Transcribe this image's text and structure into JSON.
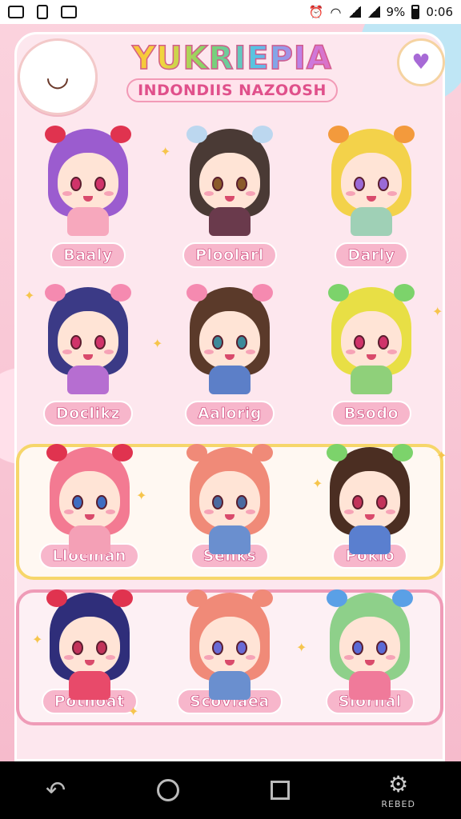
{
  "status_bar": {
    "battery": "9%",
    "time": "0:06"
  },
  "header": {
    "title": "YUKRIEPIA",
    "subtitle": "INDONDIIS NAZOOSH"
  },
  "characters": [
    {
      "name": "Baaly",
      "hair": "#9b5ccf",
      "bow": "#e0334f",
      "body": "#f7a8bd",
      "eyes": "#d0336a"
    },
    {
      "name": "Ploolarl",
      "hair": "#4a3a35",
      "bow": "#bcd7ef",
      "body": "#6a3a4c",
      "eyes": "#8a5a2a"
    },
    {
      "name": "Darly",
      "hair": "#f3d24a",
      "bow": "#f39a3c",
      "body": "#9fd0b6",
      "eyes": "#9a6ad6"
    },
    {
      "name": "Doclikz",
      "hair": "#3b3a86",
      "bow": "#f58ab0",
      "body": "#b66ed1",
      "eyes": "#d0336a"
    },
    {
      "name": "Aalorig",
      "hair": "#5b3a2a",
      "bow": "#f58ab0",
      "body": "#5c7fc8",
      "eyes": "#3c8a9a"
    },
    {
      "name": "Bsodo",
      "hair": "#e8df45",
      "bow": "#7cd36b",
      "body": "#8fd07a",
      "eyes": "#d0336a"
    },
    {
      "name": "Llocman",
      "hair": "#f37a92",
      "bow": "#e0334f",
      "body": "#f4a0b6",
      "eyes": "#3f6dc1"
    },
    {
      "name": "Senks",
      "hair": "#f08a78",
      "bow": "#f08a78",
      "body": "#6a8fcf",
      "eyes": "#4a6aa0"
    },
    {
      "name": "Poklo",
      "hair": "#4b2e22",
      "bow": "#7cd36b",
      "body": "#5a7fcf",
      "eyes": "#c2335a"
    },
    {
      "name": "Potnoat",
      "hair": "#2f2e7a",
      "bow": "#e0334f",
      "body": "#e84a6a",
      "eyes": "#c2335a"
    },
    {
      "name": "Scovlaea",
      "hair": "#f08a78",
      "bow": "#f08a78",
      "body": "#6a8fcf",
      "eyes": "#6a6ad6"
    },
    {
      "name": "Siorlial",
      "hair": "#8ed08a",
      "bow": "#5aa0e6",
      "body": "#f07a9a",
      "eyes": "#5a6ad6"
    }
  ],
  "nav": {
    "settings_label": "REBED"
  }
}
